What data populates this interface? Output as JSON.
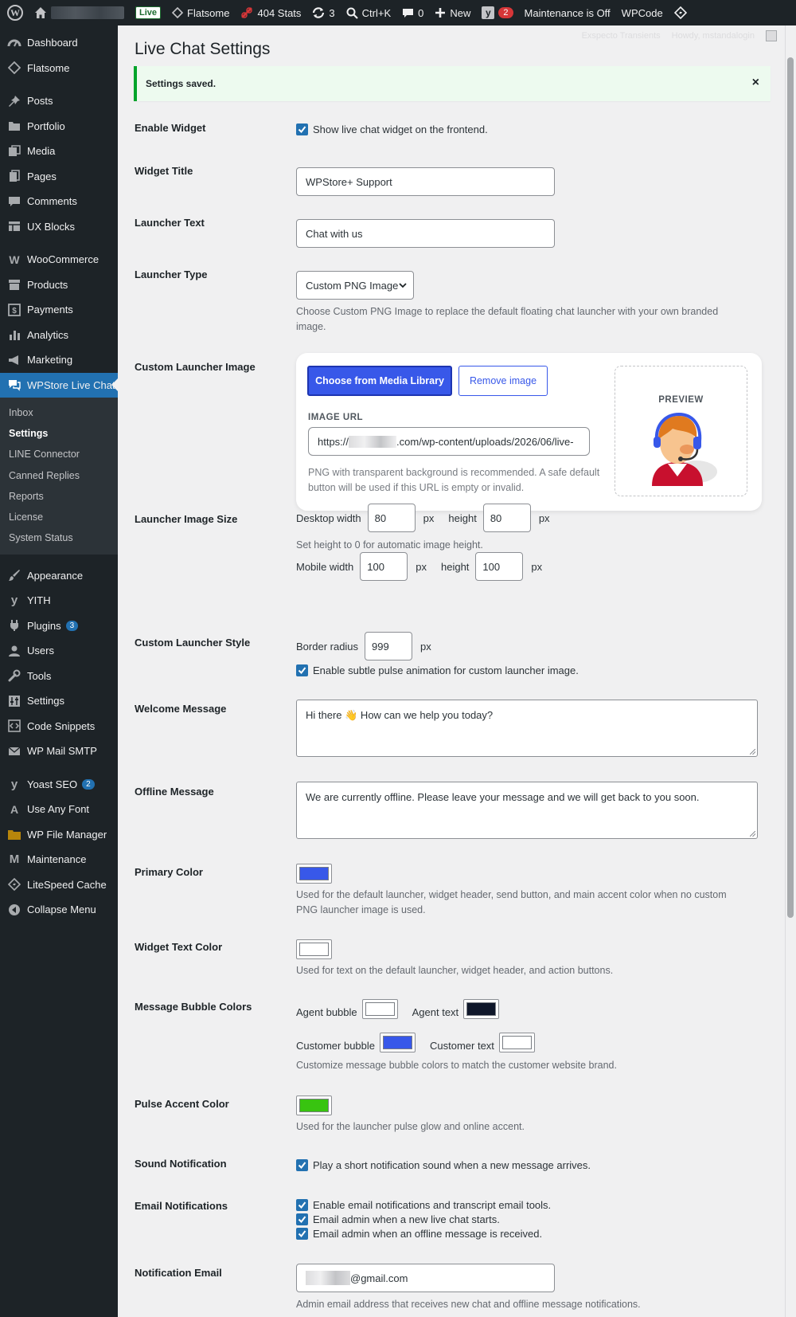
{
  "adminbar": {
    "live": "Live",
    "flatsome": "Flatsome",
    "stats": "404 Stats",
    "updates_count": "3",
    "search": "Ctrl+K",
    "comments_count": "0",
    "new": "New",
    "yoast_count": "2",
    "maintenance": "Maintenance is Off",
    "wpcode": "WPCode"
  },
  "screen_meta": {
    "left": "Exspecto Transients",
    "howdy": "Howdy, mstandalogin"
  },
  "sidebar": {
    "items_top": [
      {
        "label": "Dashboard",
        "icon": "dashboard-icon"
      },
      {
        "label": "Flatsome",
        "icon": "flatsome-icon"
      }
    ],
    "items_content": [
      {
        "label": "Posts",
        "icon": "pin-icon"
      },
      {
        "label": "Portfolio",
        "icon": "folder-icon"
      },
      {
        "label": "Media",
        "icon": "media-icon"
      },
      {
        "label": "Pages",
        "icon": "pages-icon"
      },
      {
        "label": "Comments",
        "icon": "comment-icon"
      },
      {
        "label": "UX Blocks",
        "icon": "blocks-icon"
      }
    ],
    "items_shop": [
      {
        "label": "WooCommerce",
        "icon": "woo-icon"
      },
      {
        "label": "Products",
        "icon": "archive-icon"
      },
      {
        "label": "Payments",
        "icon": "dollar-icon"
      },
      {
        "label": "Analytics",
        "icon": "bar-chart-icon"
      },
      {
        "label": "Marketing",
        "icon": "megaphone-icon"
      }
    ],
    "current": {
      "label": "WPStore Live Chat",
      "icon": "chat-bubbles-icon"
    },
    "submenu": [
      "Inbox",
      "Settings",
      "LINE Connector",
      "Canned Replies",
      "Reports",
      "License",
      "System Status"
    ],
    "items_bottom": [
      {
        "label": "Appearance",
        "icon": "brush-icon",
        "badge": ""
      },
      {
        "label": "YITH",
        "icon": "yith-icon",
        "badge": ""
      },
      {
        "label": "Plugins",
        "icon": "plug-icon",
        "badge": "3"
      },
      {
        "label": "Users",
        "icon": "user-icon",
        "badge": ""
      },
      {
        "label": "Tools",
        "icon": "wrench-icon",
        "badge": ""
      },
      {
        "label": "Settings",
        "icon": "sliders-icon",
        "badge": ""
      },
      {
        "label": "Code Snippets",
        "icon": "code-icon",
        "badge": ""
      },
      {
        "label": "WP Mail SMTP",
        "icon": "mail-icon",
        "badge": ""
      }
    ],
    "items_extra": [
      {
        "label": "Yoast SEO",
        "icon": "yoast-icon",
        "badge": "2"
      },
      {
        "label": "Use Any Font",
        "icon": "font-icon",
        "badge": ""
      },
      {
        "label": "WP File Manager",
        "icon": "file-manager-icon",
        "badge": ""
      },
      {
        "label": "Maintenance",
        "icon": "maintenance-icon",
        "badge": ""
      },
      {
        "label": "LiteSpeed Cache",
        "icon": "litespeed-icon",
        "badge": ""
      },
      {
        "label": "Collapse Menu",
        "icon": "collapse-icon",
        "badge": ""
      }
    ]
  },
  "page": {
    "title": "Live Chat Settings",
    "notice": "Settings saved.",
    "notice_dismiss": "×"
  },
  "labels": {
    "enable_widget": "Enable Widget",
    "widget_title": "Widget Title",
    "launcher_text": "Launcher Text",
    "launcher_type": "Launcher Type",
    "custom_launcher_image": "Custom Launcher Image",
    "launcher_image_size": "Launcher Image Size",
    "custom_launcher_style": "Custom Launcher Style",
    "welcome_message": "Welcome Message",
    "offline_message": "Offline Message",
    "primary_color": "Primary Color",
    "widget_text_color": "Widget Text Color",
    "message_bubble_colors": "Message Bubble Colors",
    "pulse_accent_color": "Pulse Accent Color",
    "sound_notification": "Sound Notification",
    "email_notifications": "Email Notifications",
    "notification_email": "Notification Email"
  },
  "fields": {
    "enable_widget_text": "Show live chat widget on the frontend.",
    "widget_title_value": "WPStore+ Support",
    "launcher_text_value": "Chat with us",
    "launcher_type_value": "Custom PNG Image",
    "launcher_type_desc": "Choose Custom PNG Image to replace the default floating chat launcher with your own branded image.",
    "choose_media": "Choose from Media Library",
    "remove_image": "Remove image",
    "image_url_label": "IMAGE URL",
    "image_url_prefix": "https://",
    "image_url_suffix": ".com/wp-content/uploads/2026/06/live-",
    "image_url_desc": "PNG with transparent background is recommended. A safe default button will be used if this URL is empty or invalid.",
    "preview_label": "PREVIEW",
    "desktop_width_label": "Desktop width",
    "desktop_width": "80",
    "height_label": "height",
    "desktop_height": "80",
    "px": "px",
    "height_desc": "Set height to 0 for automatic image height.",
    "mobile_width_label": "Mobile width",
    "mobile_width": "100",
    "mobile_height": "100",
    "border_radius_label": "Border radius",
    "border_radius": "999",
    "pulse_animation_text": "Enable subtle pulse animation for custom launcher image.",
    "welcome_value": "Hi there 👋 How can we help you today?",
    "offline_value": "We are currently offline. Please leave your message and we will get back to you soon.",
    "primary_color": "#3858e9",
    "primary_color_desc": "Used for the default launcher, widget header, send button, and main accent color when no custom PNG launcher image is used.",
    "widget_text_color": "#ffffff",
    "widget_text_color_desc": "Used for text on the default launcher, widget header, and action buttons.",
    "agent_bubble_label": "Agent bubble",
    "agent_bubble_color": "#ffffff",
    "agent_text_label": "Agent text",
    "agent_text_color": "#0f172a",
    "customer_bubble_label": "Customer bubble",
    "customer_bubble_color": "#3858e9",
    "customer_text_label": "Customer text",
    "customer_text_color": "#ffffff",
    "bubble_desc": "Customize message bubble colors to match the customer website brand.",
    "pulse_color": "#38c410",
    "pulse_desc": "Used for the launcher pulse glow and online accent.",
    "sound_text": "Play a short notification sound when a new message arrives.",
    "email_opt1": "Enable email notifications and transcript email tools.",
    "email_opt2": "Email admin when a new live chat starts.",
    "email_opt3": "Email admin when an offline message is received.",
    "notification_email_suffix": "@gmail.com",
    "notification_email_desc": "Admin email address that receives new chat and offline message notifications."
  }
}
